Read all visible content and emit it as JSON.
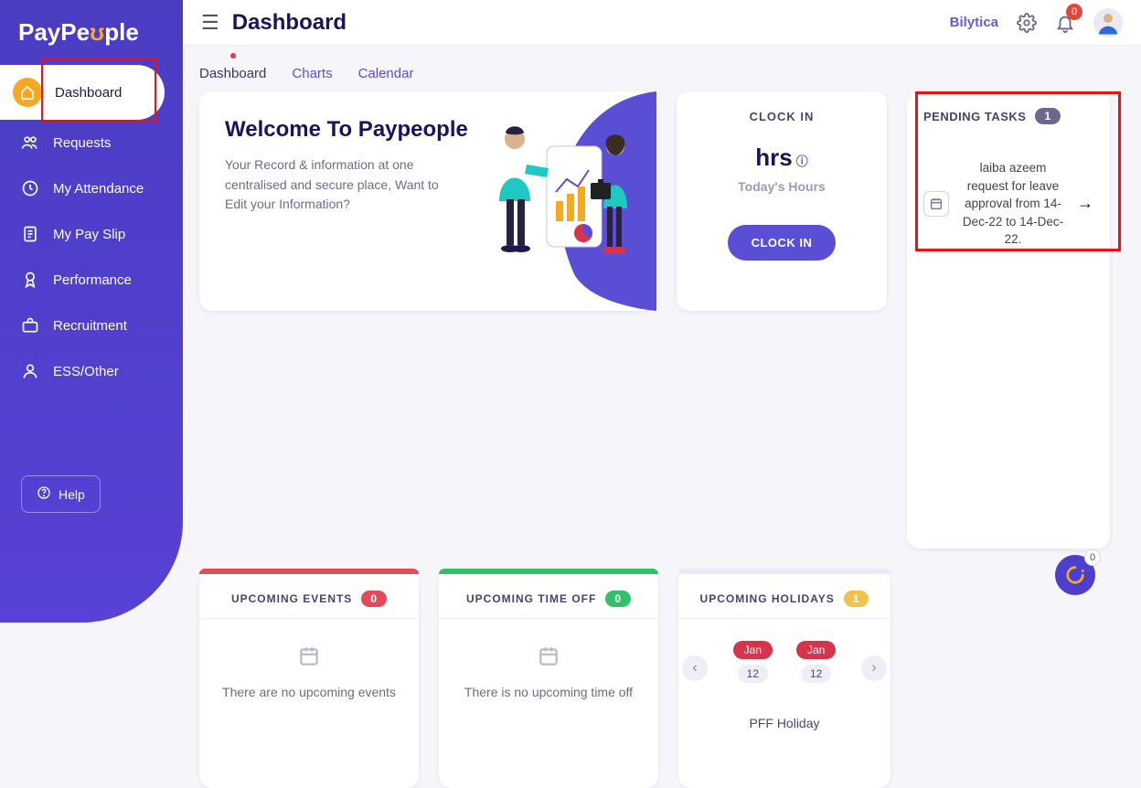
{
  "brand": "PayPeople",
  "header": {
    "title": "Dashboard",
    "company": "Bilytica",
    "notification_count": "0"
  },
  "sidebar": {
    "items": [
      {
        "label": "Dashboard",
        "icon": "home"
      },
      {
        "label": "Requests",
        "icon": "users"
      },
      {
        "label": "My Attendance",
        "icon": "clock"
      },
      {
        "label": "My Pay Slip",
        "icon": "doc"
      },
      {
        "label": "Performance",
        "icon": "ribbon"
      },
      {
        "label": "Recruitment",
        "icon": "briefcase"
      },
      {
        "label": "ESS/Other",
        "icon": "person"
      }
    ],
    "help": "Help"
  },
  "tabs": [
    {
      "label": "Dashboard",
      "active": true
    },
    {
      "label": "Charts"
    },
    {
      "label": "Calendar"
    }
  ],
  "welcome": {
    "title": "Welcome To Paypeople",
    "text": "Your Record & information at one centralised and secure place, Want to Edit your Information?"
  },
  "clock": {
    "title": "CLOCK IN",
    "hrs": "hrs",
    "info": "ⓘ",
    "subtitle": "Today's Hours",
    "button": "CLOCK IN"
  },
  "pending": {
    "title": "PENDING TASKS",
    "count": "1",
    "tasks": [
      {
        "text": "laiba azeem request for leave approval from 14-Dec-22 to 14-Dec-22."
      }
    ]
  },
  "events": {
    "title": "UPCOMING EVENTS",
    "count": "0",
    "empty": "There are no upcoming events"
  },
  "timeoff": {
    "title": "UPCOMING TIME OFF",
    "count": "0",
    "empty": "There is no upcoming time off"
  },
  "holidays": {
    "title": "UPCOMING HOLIDAYS",
    "count": "1",
    "items": [
      {
        "month": "Jan",
        "day": "12"
      },
      {
        "month": "Jan",
        "day": "12"
      }
    ],
    "name": "PFF Holiday"
  },
  "fab_count": "0"
}
